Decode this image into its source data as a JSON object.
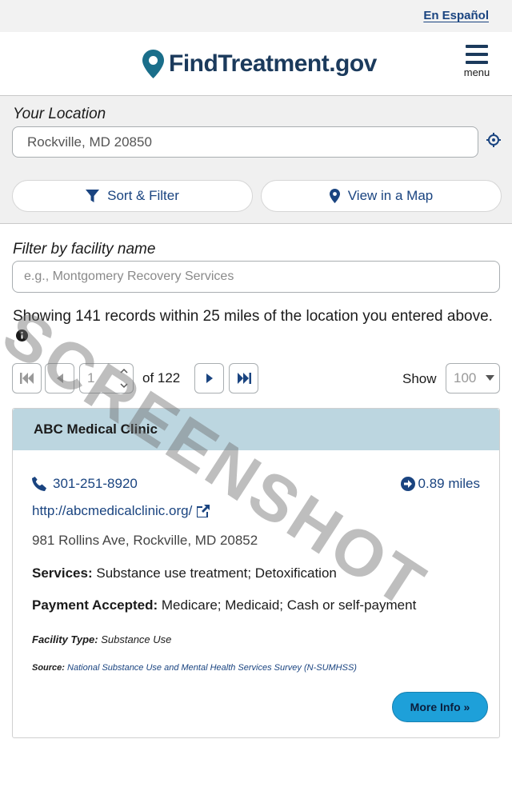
{
  "topbar": {
    "language_link": "En Español"
  },
  "header": {
    "brand": "FindTreatment.gov",
    "menu_label": "menu"
  },
  "location": {
    "label": "Your Location",
    "value": "Rockville, MD 20850"
  },
  "actions": {
    "sort_filter": "Sort & Filter",
    "view_map": "View in a Map"
  },
  "filter": {
    "label": "Filter by facility name",
    "placeholder": "e.g., Montgomery Recovery Services"
  },
  "results": {
    "showing_text": "Showing 141 records within 25 miles of the location you entered above."
  },
  "pagination": {
    "current_page": "1",
    "of_total": "of 122",
    "show_label": "Show",
    "page_size": "100"
  },
  "facility": {
    "name": "ABC Medical Clinic",
    "phone": "301-251-8920",
    "distance": "0.89 miles",
    "website": "http://abcmedicalclinic.org/",
    "address": "981 Rollins Ave, Rockville, MD 20852",
    "services_label": "Services:",
    "services": "Substance use treatment; Detoxification",
    "payment_label": "Payment Accepted:",
    "payment": "Medicare; Medicaid; Cash or self-payment",
    "type_label": "Facility Type:",
    "type": "Substance Use",
    "source_label": "Source:",
    "source": "National Substance Use and Mental Health Services Survey (N-SUMHSS)",
    "more_info": "More Info »"
  },
  "watermark": "SCREENSHOT",
  "colors": {
    "brand_navy": "#1b3a5c",
    "link_blue": "#1a4480",
    "logo_teal": "#1a6e8a",
    "card_header": "#bcd6e0",
    "more_button": "#1ea0d9"
  }
}
